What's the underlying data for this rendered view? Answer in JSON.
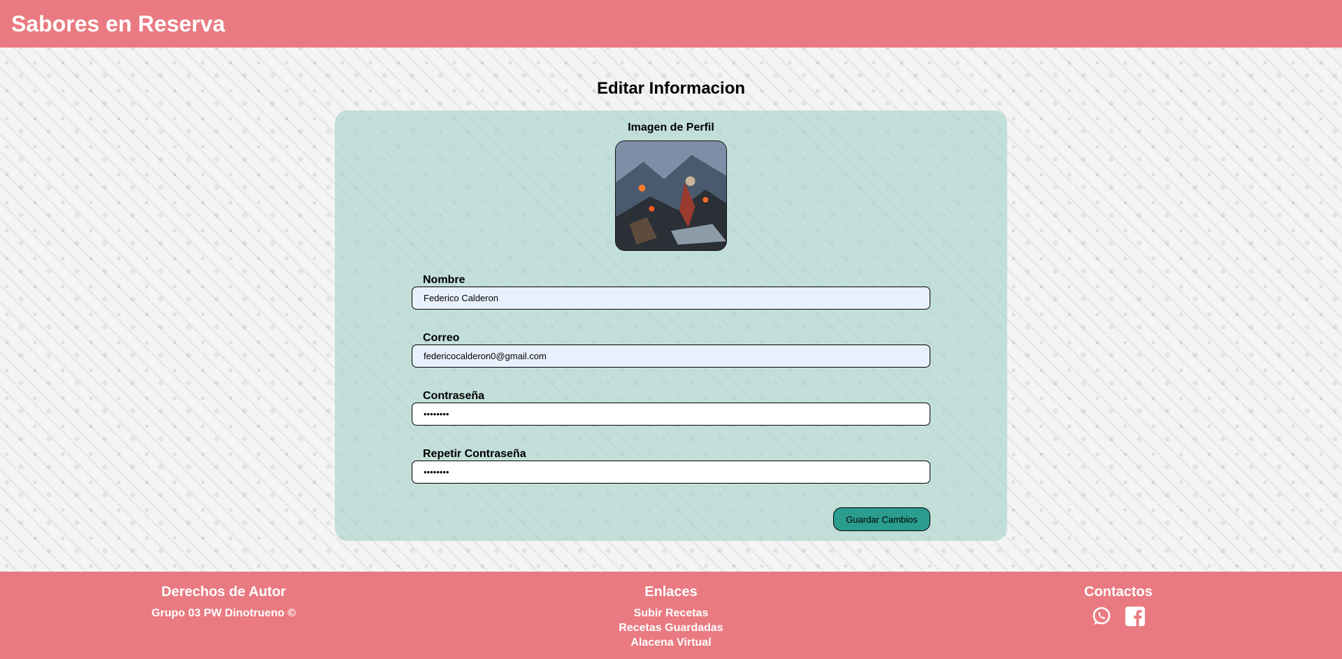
{
  "header": {
    "brand": "Sabores en Reserva"
  },
  "main": {
    "title": "Editar Informacion",
    "profile_image_label": "Imagen de Perfil",
    "fields": {
      "name_label": "Nombre",
      "name_value": "Federico Calderon",
      "email_label": "Correo",
      "email_value": "federicocalderon0@gmail.com",
      "password_label": "Contraseña",
      "password_value": "••••••••",
      "repeat_password_label": "Repetir Contraseña",
      "repeat_password_value": "••••••••"
    },
    "save_label": "Guardar Cambios"
  },
  "footer": {
    "rights_title": "Derechos de Autor",
    "rights_text": "Grupo 03 PW Dinotrueno ©",
    "links_title": "Enlaces",
    "links": [
      "Subir Recetas",
      "Recetas Guardadas",
      "Alacena Virtual"
    ],
    "contacts_title": "Contactos",
    "contact_icons": [
      "whatsapp-icon",
      "facebook-icon"
    ]
  },
  "colors": {
    "header_bg": "#ea7a81",
    "card_bg": "#abd4cd",
    "button_bg": "#2a9d8f",
    "autofill_bg": "#e8f0fe"
  }
}
